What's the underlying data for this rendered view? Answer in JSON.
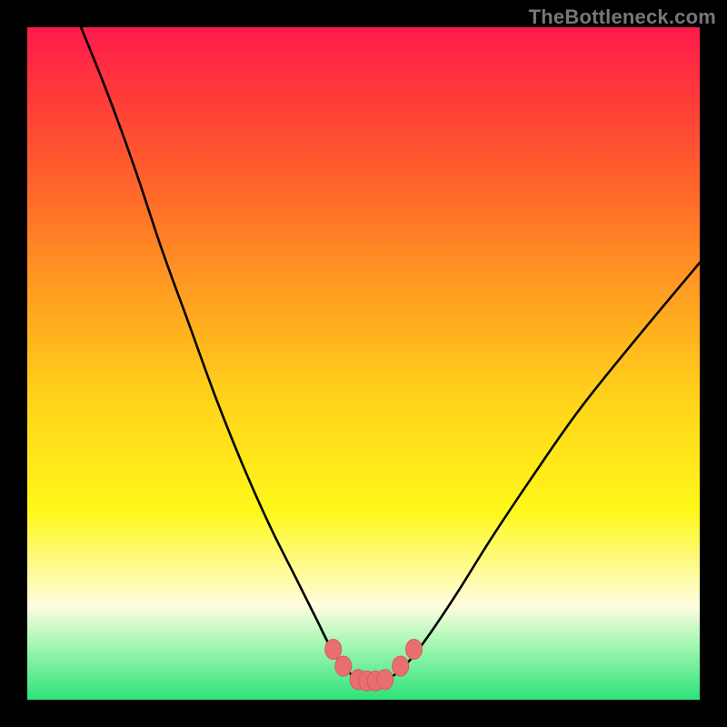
{
  "watermark": "TheBottleneck.com",
  "chart_data": {
    "type": "line",
    "title": "",
    "xlabel": "",
    "ylabel": "",
    "xlim": [
      0,
      100
    ],
    "ylim": [
      0,
      100
    ],
    "grid": false,
    "legend": false,
    "series": [
      {
        "name": "left-curve",
        "x": [
          8,
          12,
          16,
          20,
          24,
          28,
          32,
          36,
          40,
          43,
          45,
          47,
          48.5,
          49.5
        ],
        "y": [
          100,
          90,
          79,
          67,
          56,
          45,
          35,
          26,
          18,
          12,
          8,
          5,
          3.5,
          3
        ]
      },
      {
        "name": "right-curve",
        "x": [
          53.5,
          55,
          57,
          60,
          64,
          69,
          75,
          82,
          90,
          100
        ],
        "y": [
          3,
          4,
          6,
          10,
          16,
          24,
          33,
          43,
          53,
          65
        ]
      },
      {
        "name": "bottom-flat",
        "x": [
          49.5,
          50.5,
          51.5,
          52.5,
          53.5
        ],
        "y": [
          3,
          2.8,
          2.8,
          2.8,
          3
        ]
      }
    ],
    "markers": [
      {
        "name": "left-upper",
        "x": 45.5,
        "y": 7.5
      },
      {
        "name": "left-lower",
        "x": 47.0,
        "y": 5.0
      },
      {
        "name": "flat-1",
        "x": 49.2,
        "y": 3.0
      },
      {
        "name": "flat-2",
        "x": 50.5,
        "y": 2.8
      },
      {
        "name": "flat-3",
        "x": 51.8,
        "y": 2.8
      },
      {
        "name": "flat-4",
        "x": 53.2,
        "y": 3.0
      },
      {
        "name": "right-lower",
        "x": 55.5,
        "y": 5.0
      },
      {
        "name": "right-upper",
        "x": 57.5,
        "y": 7.5
      }
    ],
    "colors": {
      "curve": "#000000",
      "marker_fill": "#e96f6f",
      "marker_stroke": "#d85a5a",
      "gradient_top": "#ff1a4d",
      "gradient_bottom": "#2ee27a"
    }
  }
}
